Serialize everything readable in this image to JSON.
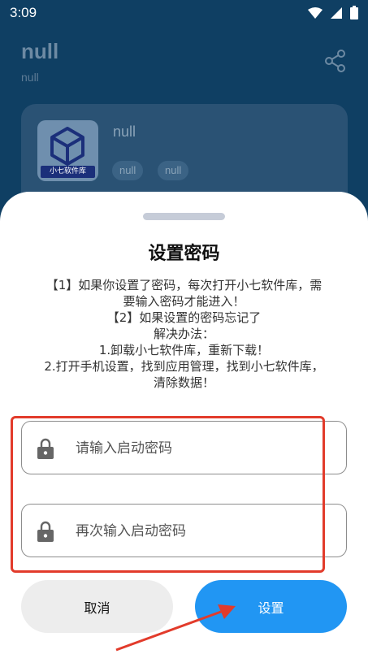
{
  "status_bar": {
    "time": "3:09"
  },
  "app": {
    "title": "null",
    "subtitle": "null",
    "card": {
      "name": "null",
      "icon_label": "小七软件库",
      "tags": [
        "null",
        "null"
      ]
    }
  },
  "dialog": {
    "title": "设置密码",
    "description_lines": [
      "【1】如果你设置了密码，每次打开小七软件库，需",
      "要输入密码才能进入！",
      "【2】如果设置的密码忘记了",
      "解决办法：",
      "1.卸载小七软件库，重新下载！",
      "2.打开手机设置，找到应用管理，找到小七软件库，",
      "清除数据！"
    ],
    "password_field": {
      "placeholder": "请输入启动密码",
      "value": ""
    },
    "confirm_field": {
      "placeholder": "再次输入启动密码",
      "value": ""
    },
    "cancel_label": "取消",
    "set_label": "设置"
  },
  "colors": {
    "primary": "#2196f3",
    "annotation": "#e23b2b",
    "background": "#0f3f63"
  }
}
